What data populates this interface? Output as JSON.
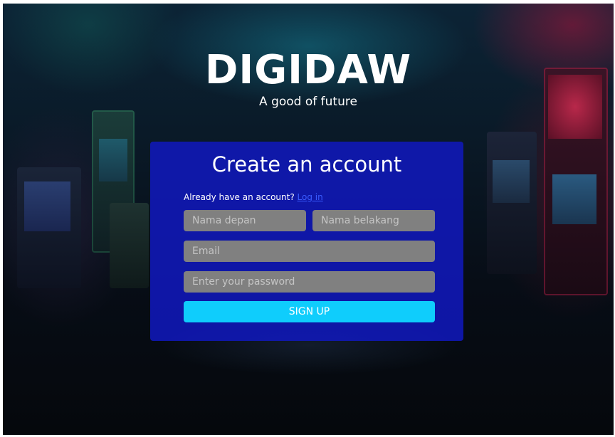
{
  "brand": {
    "title": "DIGIDAW",
    "tagline": "A good of future"
  },
  "form": {
    "title": "Create an account",
    "login_prompt": "Already have an account?",
    "login_link": "Log in",
    "first_name_placeholder": "Nama depan",
    "last_name_placeholder": "Nama belakang",
    "email_placeholder": "Email",
    "password_placeholder": "Enter your password",
    "submit_label": "SIGN UP"
  },
  "colors": {
    "card_background": "#1018be",
    "field_background": "#808080",
    "button_background": "#0fcdfc",
    "link": "#3a5cff"
  }
}
